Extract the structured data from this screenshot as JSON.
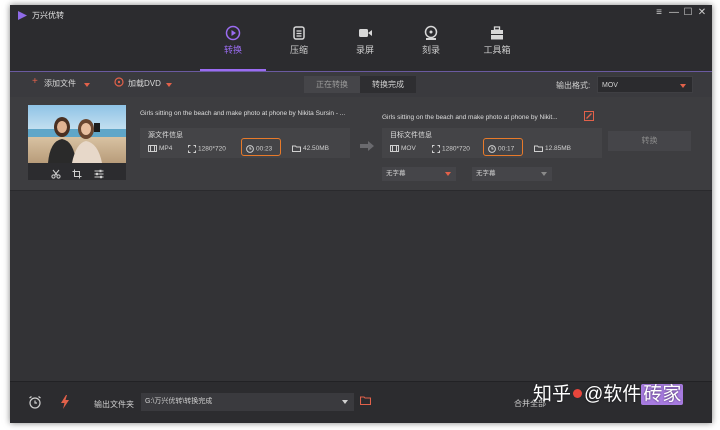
{
  "app": {
    "title": "万兴优转"
  },
  "window_controls": {
    "menu": "≡",
    "minimize": "—",
    "maximize": "☐",
    "close": "✕"
  },
  "nav": [
    {
      "label": "转换",
      "icon": "convert-icon",
      "active": true
    },
    {
      "label": "压缩",
      "icon": "compress-icon",
      "active": false
    },
    {
      "label": "录屏",
      "icon": "record-icon",
      "active": false
    },
    {
      "label": "刻录",
      "icon": "burn-icon",
      "active": false
    },
    {
      "label": "工具箱",
      "icon": "toolbox-icon",
      "active": false
    }
  ],
  "toolbar": {
    "add_file": "添加文件",
    "load_dvd": "加载DVD",
    "tab_converting": "正在转换",
    "tab_done": "转换完成",
    "output_format_label": "输出格式:",
    "output_format_value": "MOV"
  },
  "file": {
    "source_name": "Girls sitting on the beach and make photo at phone by Nikita Sursin - ...",
    "target_name": "Girls sitting on the beach and make photo at phone by Nikit...",
    "source": {
      "header": "源文件信息",
      "format": "MP4",
      "resolution": "1280*720",
      "duration": "00:23",
      "size": "42.50MB"
    },
    "target": {
      "header": "目标文件信息",
      "format": "MOV",
      "resolution": "1280*720",
      "duration": "00:17",
      "size": "12.85MB"
    },
    "convert_button": "转换",
    "subtitle_1": "无字幕",
    "subtitle_2": "无字幕"
  },
  "footer": {
    "output_folder_label": "输出文件夹",
    "output_folder_path": "G:\\万兴优转\\转换完成",
    "merge_label": "合并全部"
  },
  "watermark": {
    "text1": "知乎",
    "text2": "@软件",
    "text3": "砖家"
  },
  "colors": {
    "accent": "#9b6cf2",
    "highlight": "#e87a2a",
    "caret": "#e2614a"
  }
}
